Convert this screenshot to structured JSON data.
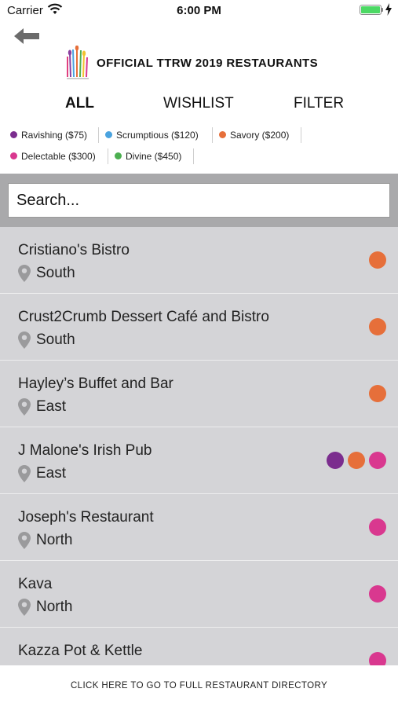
{
  "status_bar": {
    "carrier": "Carrier",
    "time": "6:00 PM"
  },
  "header": {
    "title": "OFFICIAL TTRW 2019 RESTAURANTS",
    "logo_icon": "ttrw-logo-icon",
    "back_icon": "back-arrow-icon"
  },
  "tabs": [
    {
      "label": "ALL",
      "active": true
    },
    {
      "label": "WISHLIST",
      "active": false
    },
    {
      "label": "FILTER",
      "active": false
    }
  ],
  "legend": [
    {
      "label": "Ravishing ($75)",
      "color": "#7b2d8e"
    },
    {
      "label": "Scrumptious ($120)",
      "color": "#4aa3df"
    },
    {
      "label": "Savory ($200)",
      "color": "#e66f3a"
    },
    {
      "label": "Delectable ($300)",
      "color": "#d9388f"
    },
    {
      "label": "Divine ($450)",
      "color": "#4caf50"
    }
  ],
  "search": {
    "placeholder": "Search..."
  },
  "restaurants": [
    {
      "name": "Cristiano's Bistro",
      "region": "South",
      "tiers": [
        "#e66f3a"
      ]
    },
    {
      "name": "Crust2Crumb Dessert Café and Bistro",
      "region": "South",
      "tiers": [
        "#e66f3a"
      ]
    },
    {
      "name": "Hayley’s Buffet and Bar",
      "region": "East",
      "tiers": [
        "#e66f3a"
      ]
    },
    {
      "name": "J Malone's Irish Pub",
      "region": "East",
      "tiers": [
        "#7b2d8e",
        "#e66f3a",
        "#d9388f"
      ]
    },
    {
      "name": "Joseph's Restaurant",
      "region": "North",
      "tiers": [
        "#d9388f"
      ]
    },
    {
      "name": "Kava",
      "region": "North",
      "tiers": [
        "#d9388f"
      ]
    },
    {
      "name": "Kazza Pot & Kettle",
      "region": "",
      "tiers": [
        "#d9388f"
      ]
    }
  ],
  "footer": {
    "label": "CLICK HERE TO GO TO FULL RESTAURANT DIRECTORY"
  }
}
